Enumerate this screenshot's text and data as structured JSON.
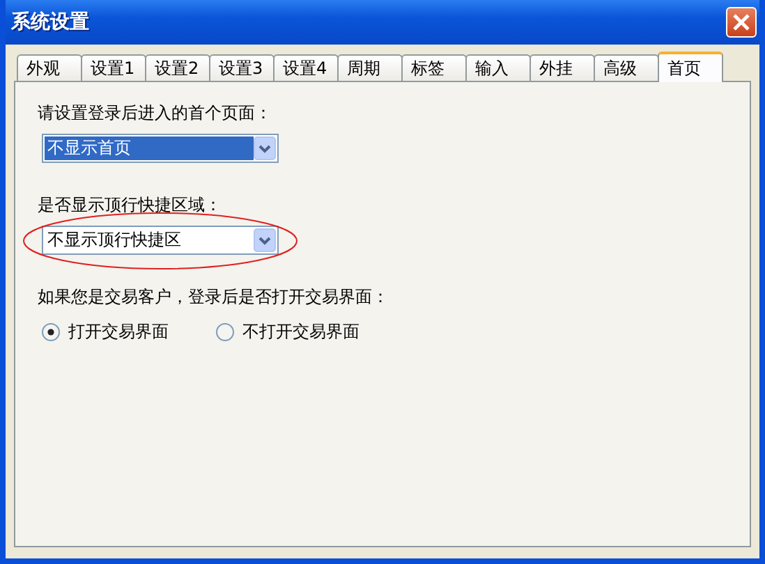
{
  "window": {
    "title": "系统设置"
  },
  "tabs": [
    {
      "label": "外观",
      "selected": false
    },
    {
      "label": "设置1",
      "selected": false
    },
    {
      "label": "设置2",
      "selected": false
    },
    {
      "label": "设置3",
      "selected": false
    },
    {
      "label": "设置4",
      "selected": false
    },
    {
      "label": "周期",
      "selected": false
    },
    {
      "label": "标签",
      "selected": false
    },
    {
      "label": "输入",
      "selected": false
    },
    {
      "label": "外挂",
      "selected": false
    },
    {
      "label": "高级",
      "selected": false
    },
    {
      "label": "首页",
      "selected": true
    }
  ],
  "settings": [
    {
      "kind": "dropdown",
      "label": "请设置登录后进入的首个页面：",
      "value": "不显示首页",
      "focused": true,
      "circled": false
    },
    {
      "kind": "dropdown",
      "label": "是否显示顶行快捷区域：",
      "value": "不显示顶行快捷区",
      "focused": false,
      "circled": true
    },
    {
      "kind": "radio",
      "label": "如果您是交易客户，登录后是否打开交易界面：",
      "options": [
        {
          "label": "打开交易界面",
          "selected": true
        },
        {
          "label": "不打开交易界面",
          "selected": false
        }
      ]
    }
  ]
}
